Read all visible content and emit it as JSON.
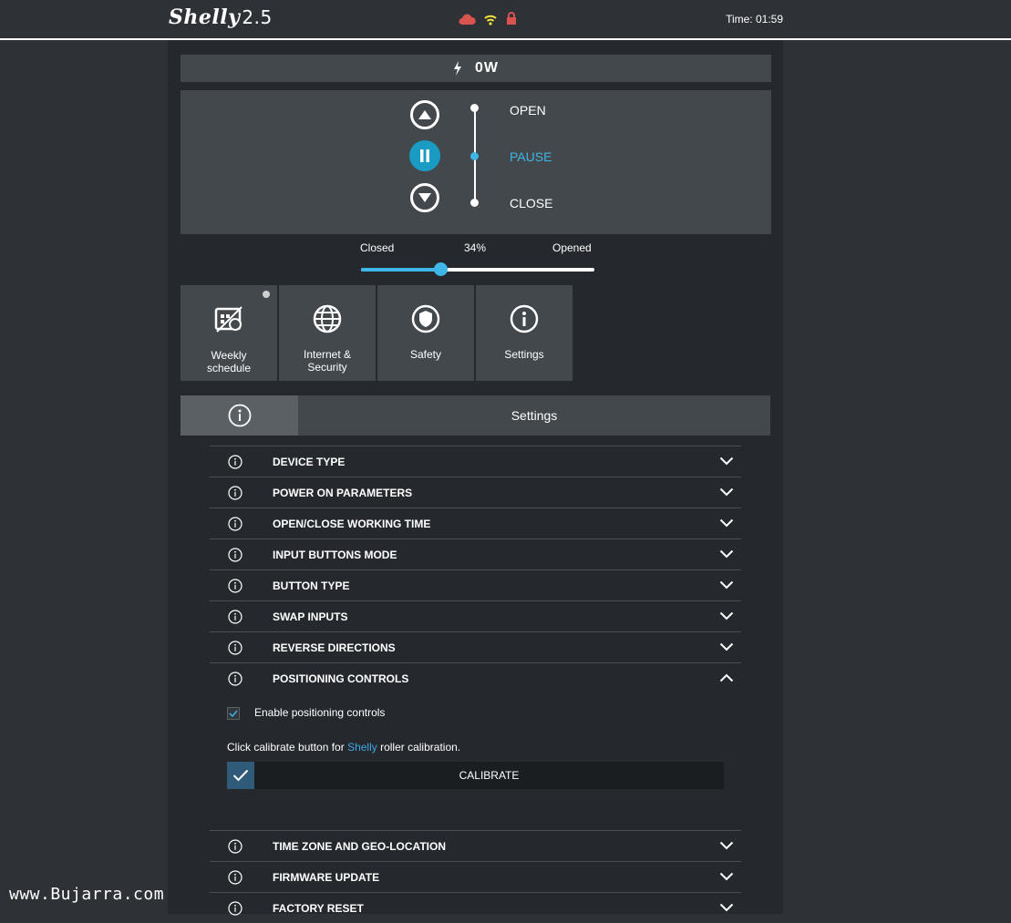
{
  "header": {
    "brand": "Shelly",
    "version": "2.5",
    "time_label": "Time:",
    "time_value": "01:59",
    "status_icons": [
      "cloud-icon",
      "wifi-icon",
      "lock-icon"
    ],
    "status_colors": {
      "cloud": "#d9534f",
      "wifi": "#f0e040",
      "lock": "#d9534f"
    }
  },
  "power": {
    "icon": "bolt-icon",
    "value": "0W"
  },
  "roller": {
    "open_label": "OPEN",
    "pause_label": "PAUSE",
    "close_label": "CLOSE",
    "active": "pause",
    "accent": "#3fb6e8"
  },
  "position": {
    "closed_label": "Closed",
    "opened_label": "Opened",
    "value_label": "34%",
    "value": 34
  },
  "tiles": [
    {
      "name": "weekly-schedule",
      "label_line1": "Weekly",
      "label_line2": "schedule",
      "icon": "calendar-icon",
      "badge": true
    },
    {
      "name": "internet-security",
      "label_line1": "Internet &",
      "label_line2": "Security",
      "icon": "globe-icon",
      "badge": false
    },
    {
      "name": "safety",
      "label_line1": "Safety",
      "label_line2": "",
      "icon": "shield-icon",
      "badge": false
    },
    {
      "name": "settings",
      "label_line1": "Settings",
      "label_line2": "",
      "icon": "info-icon",
      "badge": false
    }
  ],
  "tab": {
    "title": "Settings",
    "icon": "info-icon"
  },
  "settings_rows": [
    {
      "label": "DEVICE TYPE",
      "expanded": false
    },
    {
      "label": "POWER ON PARAMETERS",
      "expanded": false
    },
    {
      "label": "OPEN/CLOSE WORKING TIME",
      "expanded": false
    },
    {
      "label": "INPUT BUTTONS MODE",
      "expanded": false
    },
    {
      "label": "BUTTON TYPE",
      "expanded": false
    },
    {
      "label": "SWAP INPUTS",
      "expanded": false
    },
    {
      "label": "REVERSE DIRECTIONS",
      "expanded": false
    },
    {
      "label": "POSITIONING CONTROLS",
      "expanded": true
    },
    {
      "label": "TIME ZONE AND GEO-LOCATION",
      "expanded": false
    },
    {
      "label": "FIRMWARE UPDATE",
      "expanded": false
    },
    {
      "label": "FACTORY RESET",
      "expanded": false
    }
  ],
  "positioning": {
    "checkbox_label": "Enable positioning controls",
    "checkbox_checked": true,
    "hint_before": "Click calibrate button for ",
    "hint_link": "Shelly",
    "hint_after": " roller calibration.",
    "calibrate_label": "CALIBRATE"
  },
  "watermark": "www.Bujarra.com"
}
